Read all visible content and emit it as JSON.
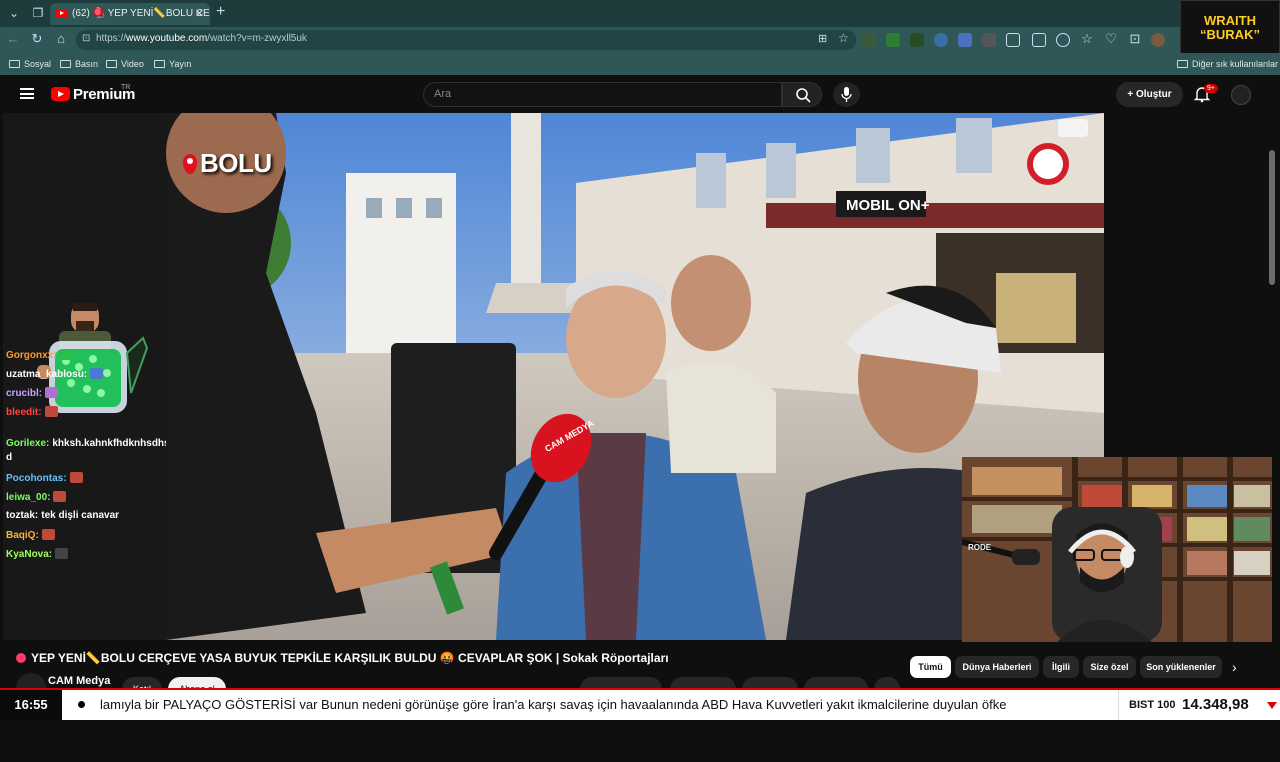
{
  "browser": {
    "tab_title": "(62) 🪀 YEP YENİ📏BOLU CER",
    "tab_close": "✕",
    "new_tab": "+",
    "url_prefix": "https://",
    "url_host": "www.youtube.com",
    "url_path": "/watch?v=m-zwyxll5uk",
    "bookmarks": [
      "Sosyal",
      "Basın",
      "Video",
      "Yayın"
    ],
    "other_bookmarks": "Diğer sık kullanılanlar",
    "overlay_badge": [
      "WRAITH",
      "“BURAK”"
    ]
  },
  "youtube": {
    "brand": "Premium",
    "region": "TR",
    "search_placeholder": "Ara",
    "create_label": "+ Oluştur",
    "notifications": "9+"
  },
  "video": {
    "location_tag": "BOLU",
    "mic_text": "CAM MEDYA"
  },
  "chat": [
    {
      "name": "Gorgonxx:",
      "text": "",
      "color": "#ff9b2f"
    },
    {
      "name": "uzatma_kablosu:",
      "text": "",
      "color": "#ffffff"
    },
    {
      "name": "crucibl:",
      "text": "",
      "color": "#c8a5ff"
    },
    {
      "name": "bleedit:",
      "text": "",
      "color": "#ff4444"
    },
    {
      "name": "Gorilexe:",
      "text": "khksh.kahnkfhdknhsdhs",
      "color": "#7cff62"
    },
    {
      "name": "d",
      "text": "",
      "color": "#ffffff"
    },
    {
      "name": "Pocohontas:",
      "text": "",
      "color": "#62c2ff"
    },
    {
      "name": "leiwa_00:",
      "text": "",
      "color": "#7cff62"
    },
    {
      "name": "toztak:",
      "text": "tek dişli canavar",
      "color": "#ffffff"
    },
    {
      "name": "BaqiQ:",
      "text": "",
      "color": "#ffb52f"
    },
    {
      "name": "KyaNova:",
      "text": "",
      "color": "#a0ff60"
    }
  ],
  "below": {
    "title": "YEP YENİ📏BOLU CERÇEVE YASA BUYUK TEPKİLE KARŞILIK BULDU 🤬 CEVAPLAR ŞOK | Sokak Röportajları",
    "channel": "CAM Medya",
    "join_label": "Katıl",
    "subscribe_label": "Abone ol",
    "chips": [
      "Tümü",
      "Dünya Haberleri",
      "İlgili",
      "Size özel",
      "Son yüklenenler"
    ],
    "chip_next": "›"
  },
  "ticker": {
    "time": "16:55",
    "text": "lamıyla bir PALYAÇO GÖSTERİSİ var Bunun nedeni görünüşe göre İran'a karşı savaş için havaalanında ABD Hava Kuvvetleri yakıt ikmalcilerine duyulan öfke",
    "index_label": "BIST 100",
    "index_value": "14.348,98"
  }
}
